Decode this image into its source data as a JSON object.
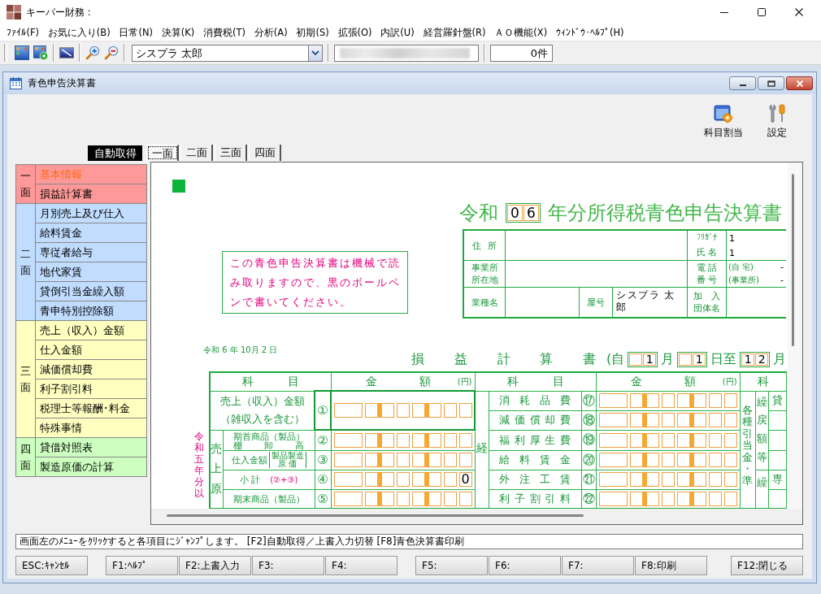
{
  "window": {
    "title": "キーパー財務 :"
  },
  "menu": [
    "ﾌｧｲﾙ(F)",
    "お気に入り(B)",
    "日常(N)",
    "決算(K)",
    "消費税(T)",
    "分析(A)",
    "初期(S)",
    "拡張(O)",
    "内訳(U)",
    "経営羅針盤(R)",
    "ＡＯ機能(X)",
    "ｳｨﾝﾄﾞｳ･ﾍﾙﾌﾟ(H)"
  ],
  "toolbar": {
    "person_field": {
      "value": "シスプラ 太郎"
    },
    "count_field": {
      "value": "0件"
    }
  },
  "document": {
    "title": "青色申告決算書",
    "tools": [
      {
        "kind": "assign",
        "label": "科目割当"
      },
      {
        "kind": "settings",
        "label": "設定"
      }
    ]
  },
  "mode_label": "自動取得",
  "tabs": [
    {
      "label": "一面",
      "selected": true
    },
    {
      "label": "二面",
      "selected": false
    },
    {
      "label": "三面",
      "selected": false
    },
    {
      "label": "四面",
      "selected": false
    }
  ],
  "sidebar": [
    {
      "label": "一面",
      "color": "#ff9999",
      "items": [
        {
          "label": "基本情報",
          "selected": true
        },
        {
          "label": "損益計算書",
          "selected": false
        }
      ]
    },
    {
      "label": "二面",
      "color": "#c0dcff",
      "items": [
        {
          "label": "月別売上及び仕入",
          "selected": false
        },
        {
          "label": "給料賃金",
          "selected": false
        },
        {
          "label": "専従者給与",
          "selected": false
        },
        {
          "label": "地代家賃",
          "selected": false
        },
        {
          "label": "貸倒引当金繰入額",
          "selected": false
        },
        {
          "label": "青申特別控除額",
          "selected": false
        }
      ]
    },
    {
      "label": "三面",
      "color": "#ffffc0",
      "items": [
        {
          "label": "売上（収入）金額",
          "selected": false
        },
        {
          "label": "仕入金額",
          "selected": false
        },
        {
          "label": "減価償却費",
          "selected": false
        },
        {
          "label": "利子割引料",
          "selected": false
        },
        {
          "label": "税理士等報酬･料金",
          "selected": false
        },
        {
          "label": "特殊事情",
          "selected": false
        }
      ]
    },
    {
      "label": "四面",
      "color": "#ccffc0",
      "items": [
        {
          "label": "貸借対照表",
          "selected": false
        },
        {
          "label": "製造原価の計算",
          "selected": false
        }
      ]
    }
  ],
  "form": {
    "era": "令和",
    "year_digits": [
      "0",
      "6"
    ],
    "title": "年分所得税青色申告決算書",
    "notice": "この青色申告決算書は機械で読み取りますので、黒のボールペンで書いてください。",
    "info": {
      "address_label": "住 所",
      "furigana_label": "ﾌﾘｶﾞﾅ",
      "furigana": "1",
      "name_label": "氏 名",
      "name": "1",
      "office_label": [
        "事業所",
        "所在地"
      ],
      "phone_label": [
        "電 話",
        "番 号"
      ],
      "phones": [
        {
          "label": "(自 宅)",
          "value": "-"
        },
        {
          "label": "(事業所)",
          "value": "-"
        }
      ],
      "business_label": "業種名",
      "shop_label": "屋号",
      "shop": "シスプラ 太郎",
      "association_label": [
        "加 入",
        "団体名"
      ]
    },
    "date": "令和 6 年 10月 2 日",
    "statement_title": "損 益 計 算 書",
    "period": [
      {
        "kind": "text",
        "text": "(自"
      },
      {
        "kind": "digits",
        "digits": [
          "1"
        ]
      },
      {
        "kind": "text",
        "text": "月"
      },
      {
        "kind": "digits",
        "digits": [
          "1"
        ]
      },
      {
        "kind": "text",
        "text": "日至"
      },
      {
        "kind": "digits",
        "digits": [
          "1",
          "2"
        ]
      },
      {
        "kind": "text",
        "text": "月"
      }
    ],
    "table": {
      "headers": [
        {
          "text": "科 目"
        },
        {
          "text": "金 額",
          "unit": "(円)"
        },
        {
          "text": "科 目"
        },
        {
          "text": "金 額",
          "unit": "(円)"
        },
        {
          "text": "科"
        }
      ],
      "side_note": "令和五年分以",
      "revenue": {
        "no": "①",
        "lines": [
          "売上（収入）金額",
          "（雑収入を含む）"
        ]
      },
      "cost": {
        "label": "売上原",
        "rows": [
          {
            "no": "②",
            "lines": [
              "期首商品（製品）",
              "棚 卸 高"
            ]
          },
          {
            "no": "③",
            "lines": [
              "仕入金額"
            ],
            "note": [
              "製品製造",
              "原 価"
            ]
          },
          {
            "no": "④",
            "lines": [
              "小 計"
            ],
            "formula": "(②+③)",
            "value": "0"
          },
          {
            "no": "⑤",
            "lines": [
              "期末商品（製品）"
            ]
          }
        ]
      },
      "expenses": {
        "label": "経",
        "rows": [
          {
            "no": "⑰",
            "label": "消 耗 品 費"
          },
          {
            "no": "⑱",
            "label": "減 価 償 却 費"
          },
          {
            "no": "⑲",
            "label": "福 利 厚 生 費"
          },
          {
            "no": "⑳",
            "label": "給 料 賃 金"
          },
          {
            "no": "㉑",
            "label": "外 注 工 賃"
          },
          {
            "no": "㉒",
            "label": "利 子 割 引 料"
          }
        ]
      },
      "reserves": {
        "label": "各種引当金・準",
        "groups": [
          {
            "label": "繰戻額等",
            "first": "貸"
          },
          {
            "label": "繰",
            "first": "専"
          }
        ]
      }
    }
  },
  "status": "画面左のﾒﾆｭｰをｸﾘｯｸすると各項目にｼﾞｬﾝﾌﾟします。 [F2]自動取得／上書入力切替 [F8]青色決算書印刷",
  "function_keys": [
    [
      "ESC:ｷｬﾝｾﾙ"
    ],
    [
      "F1:ﾍﾙﾌﾟ",
      "F2:上書入力",
      "F3:",
      "F4:"
    ],
    [
      "F5:",
      "F6:",
      "F7:",
      "F8:印刷"
    ],
    [
      "F12:閉じる"
    ]
  ]
}
